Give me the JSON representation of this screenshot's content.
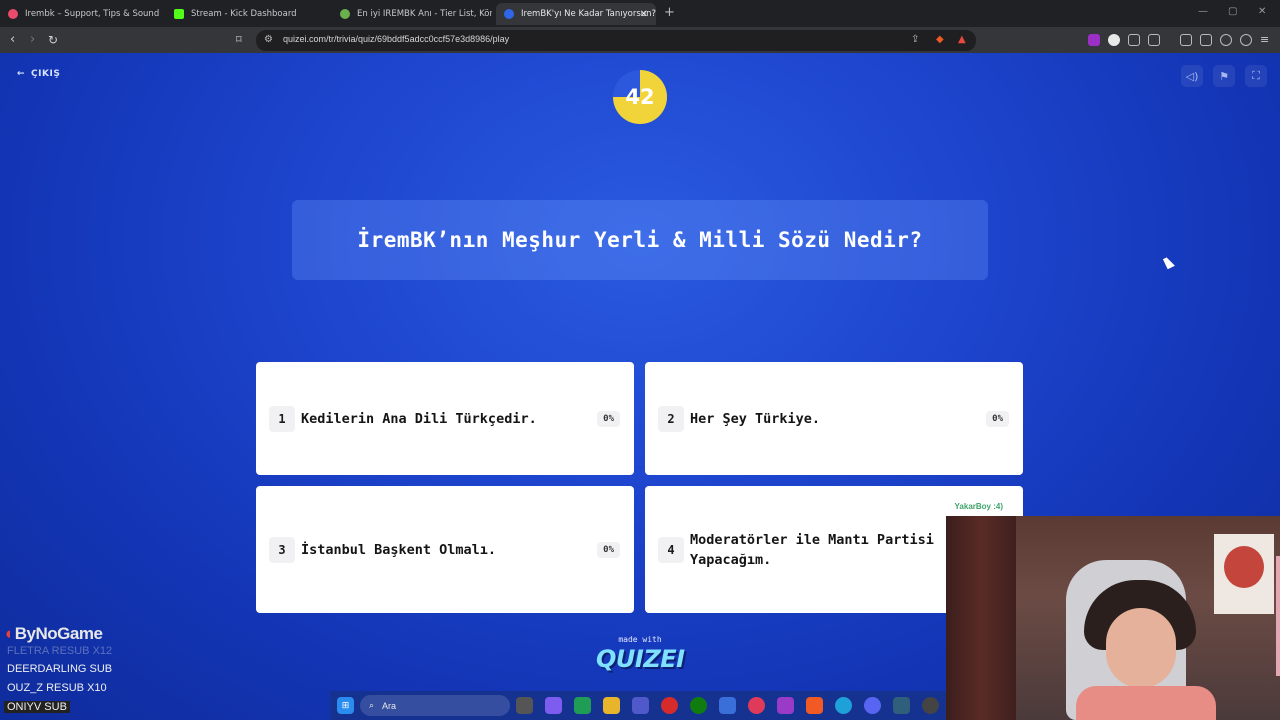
{
  "browser": {
    "tabs": [
      {
        "title": "Irembk – Support, Tips & Sound Alerts",
        "favicon_color": "#e84c6a",
        "active": false
      },
      {
        "title": "Stream - Kick Dashboard",
        "favicon_color": "#53fc18",
        "active": false
      },
      {
        "title": "En iyi IREMBK Anı - Tier List, Kör Sıralama",
        "favicon_color": "#6ab04c",
        "active": false
      },
      {
        "title": "IremBK'yı Ne Kadar Tanıyorsun?",
        "favicon_color": "#2f66e8",
        "active": true
      }
    ],
    "new_tab": "+",
    "url": "quizei.com/tr/trivia/quiz/69bddf5adcc0ccf57e3d8986/play"
  },
  "quiz": {
    "exit_label": "ÇIKIŞ",
    "timer_value": "42",
    "timer_fraction_remaining": 0.75,
    "question": "İremBK’nın Meşhur Yerli & Milli Sözü Nedir?",
    "answers": [
      {
        "number": "1",
        "text": "Kedilerin Ana Dili Türkçedir.",
        "percent": "0%"
      },
      {
        "number": "2",
        "text": "Her Şey Türkiye.",
        "percent": "0%"
      },
      {
        "number": "3",
        "text": "İstanbul Başkent Olmalı.",
        "percent": "0%"
      },
      {
        "number": "4",
        "text": "Moderatörler ile Mantı Partisi Yapacağım.",
        "voter": "YakarBoy :4)"
      }
    ],
    "made_with": "made with",
    "brand": "QUIZEI"
  },
  "overlay": {
    "brand": "ByNoGame",
    "lines": [
      {
        "text": "FLETRA  RESUB X12",
        "style": "dim"
      },
      {
        "text": "DEERDARLING  SUB",
        "style": "normal"
      },
      {
        "text": "OUZ_Z  RESUB X10",
        "style": "normal"
      },
      {
        "text": "ONIYV  SUB",
        "style": "box"
      }
    ]
  },
  "taskbar": {
    "search_placeholder": "Ara"
  },
  "colors": {
    "page_bg": "#1e46cf",
    "timer_yellow": "#f1d33a",
    "answer_bg": "#ffffff"
  }
}
